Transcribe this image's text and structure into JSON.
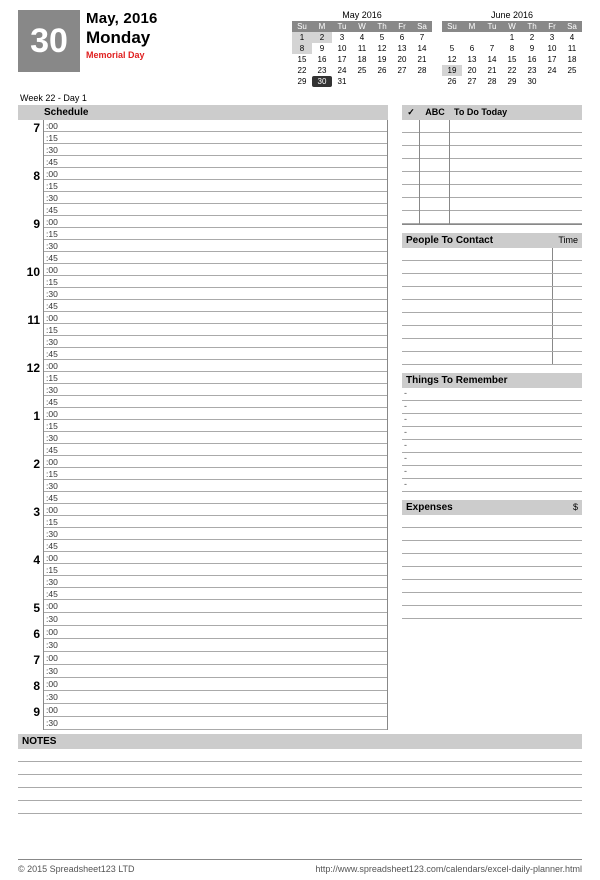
{
  "date": {
    "day_number": "30",
    "month_year": "May, 2016",
    "weekday": "Monday",
    "holiday": "Memorial Day",
    "week_label": "Week 22 - Day 1"
  },
  "minicals": [
    {
      "title": "May 2016",
      "dow": [
        "Su",
        "M",
        "Tu",
        "W",
        "Th",
        "Fr",
        "Sa"
      ],
      "weeks": [
        [
          {
            "d": "1",
            "hl": true
          },
          {
            "d": "2",
            "hl": true
          },
          {
            "d": "3"
          },
          {
            "d": "4"
          },
          {
            "d": "5"
          },
          {
            "d": "6"
          },
          {
            "d": "7"
          }
        ],
        [
          {
            "d": "8",
            "hl": true
          },
          {
            "d": "9"
          },
          {
            "d": "10"
          },
          {
            "d": "11"
          },
          {
            "d": "12"
          },
          {
            "d": "13"
          },
          {
            "d": "14"
          }
        ],
        [
          {
            "d": "15"
          },
          {
            "d": "16"
          },
          {
            "d": "17"
          },
          {
            "d": "18"
          },
          {
            "d": "19"
          },
          {
            "d": "20"
          },
          {
            "d": "21"
          }
        ],
        [
          {
            "d": "22"
          },
          {
            "d": "23"
          },
          {
            "d": "24"
          },
          {
            "d": "25"
          },
          {
            "d": "26"
          },
          {
            "d": "27"
          },
          {
            "d": "28"
          }
        ],
        [
          {
            "d": "29"
          },
          {
            "d": "30",
            "today": true
          },
          {
            "d": "31"
          },
          {
            "d": ""
          },
          {
            "d": ""
          },
          {
            "d": ""
          },
          {
            "d": ""
          }
        ]
      ]
    },
    {
      "title": "June 2016",
      "dow": [
        "Su",
        "M",
        "Tu",
        "W",
        "Th",
        "Fr",
        "Sa"
      ],
      "weeks": [
        [
          {
            "d": ""
          },
          {
            "d": ""
          },
          {
            "d": ""
          },
          {
            "d": "1"
          },
          {
            "d": "2"
          },
          {
            "d": "3"
          },
          {
            "d": "4"
          }
        ],
        [
          {
            "d": "5"
          },
          {
            "d": "6"
          },
          {
            "d": "7"
          },
          {
            "d": "8"
          },
          {
            "d": "9"
          },
          {
            "d": "10"
          },
          {
            "d": "11"
          }
        ],
        [
          {
            "d": "12"
          },
          {
            "d": "13"
          },
          {
            "d": "14"
          },
          {
            "d": "15"
          },
          {
            "d": "16"
          },
          {
            "d": "17"
          },
          {
            "d": "18"
          }
        ],
        [
          {
            "d": "19",
            "hl": true
          },
          {
            "d": "20"
          },
          {
            "d": "21"
          },
          {
            "d": "22"
          },
          {
            "d": "23"
          },
          {
            "d": "24"
          },
          {
            "d": "25"
          }
        ],
        [
          {
            "d": "26"
          },
          {
            "d": "27"
          },
          {
            "d": "28"
          },
          {
            "d": "29"
          },
          {
            "d": "30"
          },
          {
            "d": ""
          },
          {
            "d": ""
          }
        ]
      ]
    }
  ],
  "schedule": {
    "header": "Schedule",
    "hours_full": [
      {
        "h": "7",
        "mins": [
          ":00",
          ":15",
          ":30",
          ":45"
        ]
      },
      {
        "h": "8",
        "mins": [
          ":00",
          ":15",
          ":30",
          ":45"
        ]
      },
      {
        "h": "9",
        "mins": [
          ":00",
          ":15",
          ":30",
          ":45"
        ]
      },
      {
        "h": "10",
        "mins": [
          ":00",
          ":15",
          ":30",
          ":45"
        ]
      },
      {
        "h": "11",
        "mins": [
          ":00",
          ":15",
          ":30",
          ":45"
        ]
      },
      {
        "h": "12",
        "mins": [
          ":00",
          ":15",
          ":30",
          ":45"
        ]
      },
      {
        "h": "1",
        "mins": [
          ":00",
          ":15",
          ":30",
          ":45"
        ]
      },
      {
        "h": "2",
        "mins": [
          ":00",
          ":15",
          ":30",
          ":45"
        ]
      },
      {
        "h": "3",
        "mins": [
          ":00",
          ":15",
          ":30",
          ":45"
        ]
      },
      {
        "h": "4",
        "mins": [
          ":00",
          ":15",
          ":30",
          ":45"
        ]
      }
    ],
    "hours_half": [
      {
        "h": "5",
        "mins": [
          ":00",
          ":30"
        ]
      },
      {
        "h": "6",
        "mins": [
          ":00",
          ":30"
        ]
      },
      {
        "h": "7",
        "mins": [
          ":00",
          ":30"
        ]
      },
      {
        "h": "8",
        "mins": [
          ":00",
          ":30"
        ]
      },
      {
        "h": "9",
        "mins": [
          ":00",
          ":30"
        ]
      }
    ]
  },
  "todo": {
    "col_check": "✓",
    "col_abc": "ABC",
    "col_title": "To Do Today",
    "rows": 8
  },
  "contact": {
    "title": "People To Contact",
    "time_label": "Time",
    "rows": 9
  },
  "remember": {
    "title": "Things To Remember",
    "bullets": [
      "-",
      "-",
      "-",
      "-",
      "-",
      "-",
      "-",
      "-"
    ]
  },
  "expenses": {
    "title": "Expenses",
    "symbol": "$",
    "rows": 8
  },
  "notes": {
    "title": "NOTES",
    "rows": 5
  },
  "footer": {
    "left": "© 2015 Spreadsheet123 LTD",
    "right": "http://www.spreadsheet123.com/calendars/excel-daily-planner.html"
  }
}
